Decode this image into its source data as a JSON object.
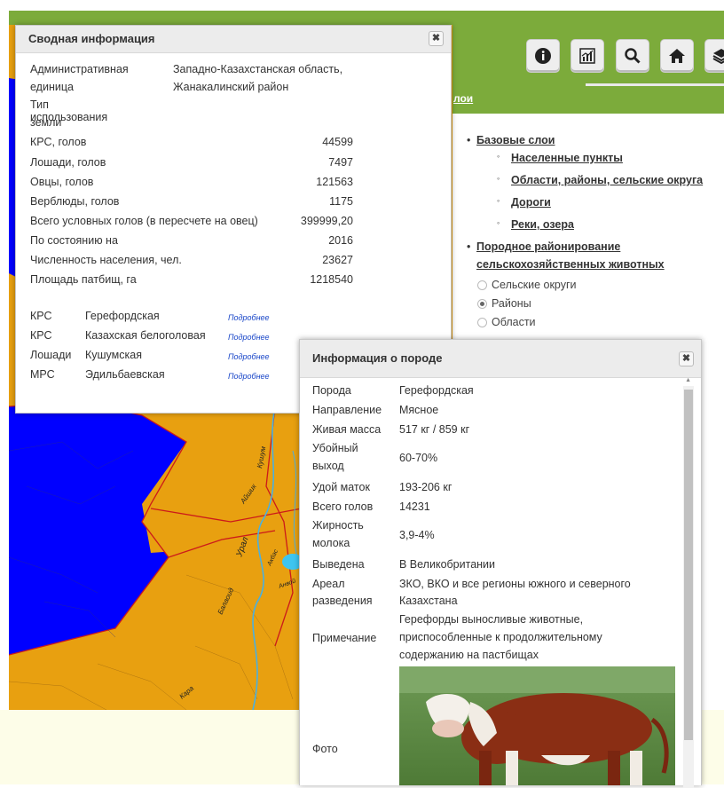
{
  "header": {
    "toolbar": [
      {
        "name": "info-icon"
      },
      {
        "name": "chart-icon"
      },
      {
        "name": "search-icon"
      },
      {
        "name": "home-icon"
      },
      {
        "name": "layers-icon"
      }
    ],
    "layers_link": "лои"
  },
  "colors": {
    "brand_green": "#7cab3b",
    "map_blue": "#0000ff",
    "map_orange": "#e8a010",
    "footer": "#fdfde8"
  },
  "layers_panel": {
    "base": "Базовые слои",
    "base_items": [
      "Населенные пункты",
      "Области, районы, сельские округа",
      "Дороги",
      "Реки, озера"
    ],
    "breed": "Породное районирование сельскохозяйственных животных",
    "breed_line1": "Породное районирование",
    "breed_line2": "сельскохозяйственных животных",
    "radios": [
      {
        "label": "Сельские округи",
        "checked": false
      },
      {
        "label": "Районы",
        "checked": true
      },
      {
        "label": "Области",
        "checked": false
      }
    ]
  },
  "map_labels": {
    "ural": "Урал",
    "ayshik": "Айшик",
    "kushum": "Кушум",
    "balaoid": "Балаоид",
    "akbas": "Акбас",
    "anyoy": "Анвой",
    "kara": "Кара"
  },
  "summary": {
    "title": "Сводная информация",
    "close": "✖",
    "admin_label_1": "Административная",
    "admin_label_2": "единица",
    "admin_value_1": "Западно-Казахстанская область,",
    "admin_value_2": "Жанакалинский район",
    "land_label_1": "Тип использования",
    "land_label_2": "земли",
    "rows": [
      {
        "label": "КРС, голов",
        "value": "44599"
      },
      {
        "label": "Лошади, голов",
        "value": "7497"
      },
      {
        "label": "Овцы, голов",
        "value": "121563"
      },
      {
        "label": "Верблюды, голов",
        "value": "1175"
      },
      {
        "label": "Всего условных голов (в пересчете на овец)",
        "value": "399999,20"
      },
      {
        "label": "По состоянию на",
        "value": "2016"
      },
      {
        "label": "Численность населения, чел.",
        "value": "23627"
      },
      {
        "label": "Площадь патбищ, га",
        "value": "1218540"
      }
    ],
    "breeds": [
      {
        "type": "КРС",
        "name": "Герефордская",
        "more": "Подробнее"
      },
      {
        "type": "КРС",
        "name": "Казахская белоголовая",
        "more": "Подробнее"
      },
      {
        "type": "Лошади",
        "name": "Кушумская",
        "more": "Подробнее"
      },
      {
        "type": "МРС",
        "name": "Эдильбаевская",
        "more": "Подробнее"
      }
    ]
  },
  "breed_info": {
    "title": "Информация о породе",
    "close": "✖",
    "rows": [
      {
        "k": "Порода",
        "v": "Герефордская"
      },
      {
        "k": "Направление",
        "v": "Мясное"
      },
      {
        "k": "Живая масса",
        "v": "517 кг / 859 кг"
      },
      {
        "k1": "Убойный",
        "k2": "выход",
        "v": "60-70%"
      },
      {
        "k": "Удой маток",
        "v": "193-206 кг"
      },
      {
        "k": "Всего голов",
        "v": "14231"
      },
      {
        "k1": "Жирность",
        "k2": "молока",
        "v": "3,9-4%"
      },
      {
        "k": "Выведена",
        "v": "В Великобритании"
      },
      {
        "k1": "Ареал",
        "k2": "разведения",
        "v1": "ЗКО, ВКО и все регионы южного и северного",
        "v2": "Казахстана"
      },
      {
        "k": "Примечание",
        "v1": "Герефорды выносливые животные,",
        "v2": "приспособленные к продолжительному",
        "v3": "содержанию на пастбищах"
      },
      {
        "k": "Фото"
      }
    ]
  }
}
